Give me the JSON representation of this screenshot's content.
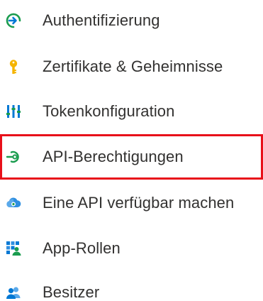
{
  "nav": {
    "items": [
      {
        "label": "Authentifizierung",
        "icon": "authentication-icon"
      },
      {
        "label": "Zertifikate & Geheimnisse",
        "icon": "key-icon"
      },
      {
        "label": "Tokenkonfiguration",
        "icon": "token-configuration-icon"
      },
      {
        "label": "API-Berechtigungen",
        "icon": "api-permissions-icon",
        "highlighted": true
      },
      {
        "label": "Eine API verfügbar machen",
        "icon": "expose-api-cloud-icon"
      },
      {
        "label": "App-Rollen",
        "icon": "app-roles-icon"
      },
      {
        "label": "Besitzer",
        "icon": "owners-icon"
      }
    ]
  },
  "colors": {
    "highlight_border": "#e8101a",
    "text": "#323130",
    "icon_green": "#1a9c4e",
    "icon_blue": "#0078d4",
    "icon_yellow": "#f5b400"
  }
}
